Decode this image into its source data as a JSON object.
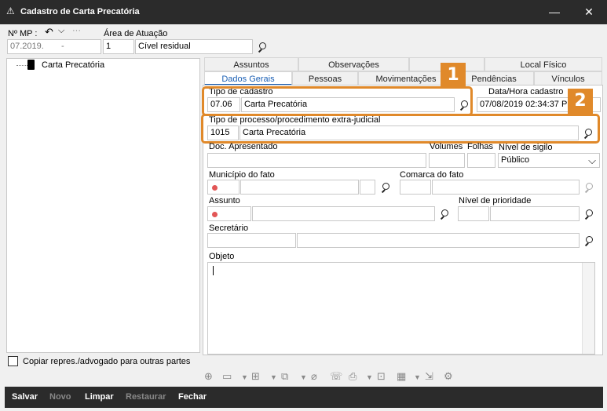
{
  "window": {
    "title": "Cadastro de Carta Precatória",
    "minimize": "—",
    "close": "✕"
  },
  "header": {
    "mp_label": "Nº MP :",
    "mp_value": "07.2019.",
    "mp_dash": "-",
    "area_label": "Área de Atuação",
    "area_code": "1",
    "area_name": "Cível residual"
  },
  "tree": {
    "root_label": "Carta Precatória"
  },
  "tabs": {
    "row1": [
      "Assuntos",
      "Observações",
      "",
      "Local Físico"
    ],
    "row2": [
      "Dados Gerais",
      "Pessoas",
      "Movimentações",
      "Pendências",
      "Vínculos"
    ]
  },
  "form": {
    "tipo_cadastro_label": "Tipo de cadastro",
    "tipo_cadastro_code": "07.06",
    "tipo_cadastro_name": "Carta Precatória",
    "data_hora_label": "Data/Hora cadastro",
    "data_hora_value": "07/08/2019 02:34:37 PM",
    "tipo_processo_label": "Tipo de processo/procedimento extra-judicial",
    "tipo_processo_code": "1015",
    "tipo_processo_name": "Carta Precatória",
    "doc_label": "Doc. Apresentado",
    "volumes_label": "Volumes",
    "folhas_label": "Folhas",
    "sigilo_label": "Nível de sigilo",
    "sigilo_value": "Público",
    "municipio_label": "Município do fato",
    "comarca_label": "Comarca do fato",
    "assunto_label": "Assunto",
    "prioridade_label": "Nível de prioridade",
    "secretario_label": "Secretário",
    "objeto_label": "Objeto"
  },
  "annotations": {
    "badge1": "1",
    "badge2": "2"
  },
  "copy_checkbox_label": "Copiar repres./advogado para outras partes",
  "actions": {
    "salvar": "Salvar",
    "novo": "Novo",
    "limpar": "Limpar",
    "restaurar": "Restaurar",
    "fechar": "Fechar"
  },
  "colors": {
    "accent": "#e0892a",
    "titlebar": "#2b2b2b",
    "tab_active": "#1a5fb4"
  }
}
